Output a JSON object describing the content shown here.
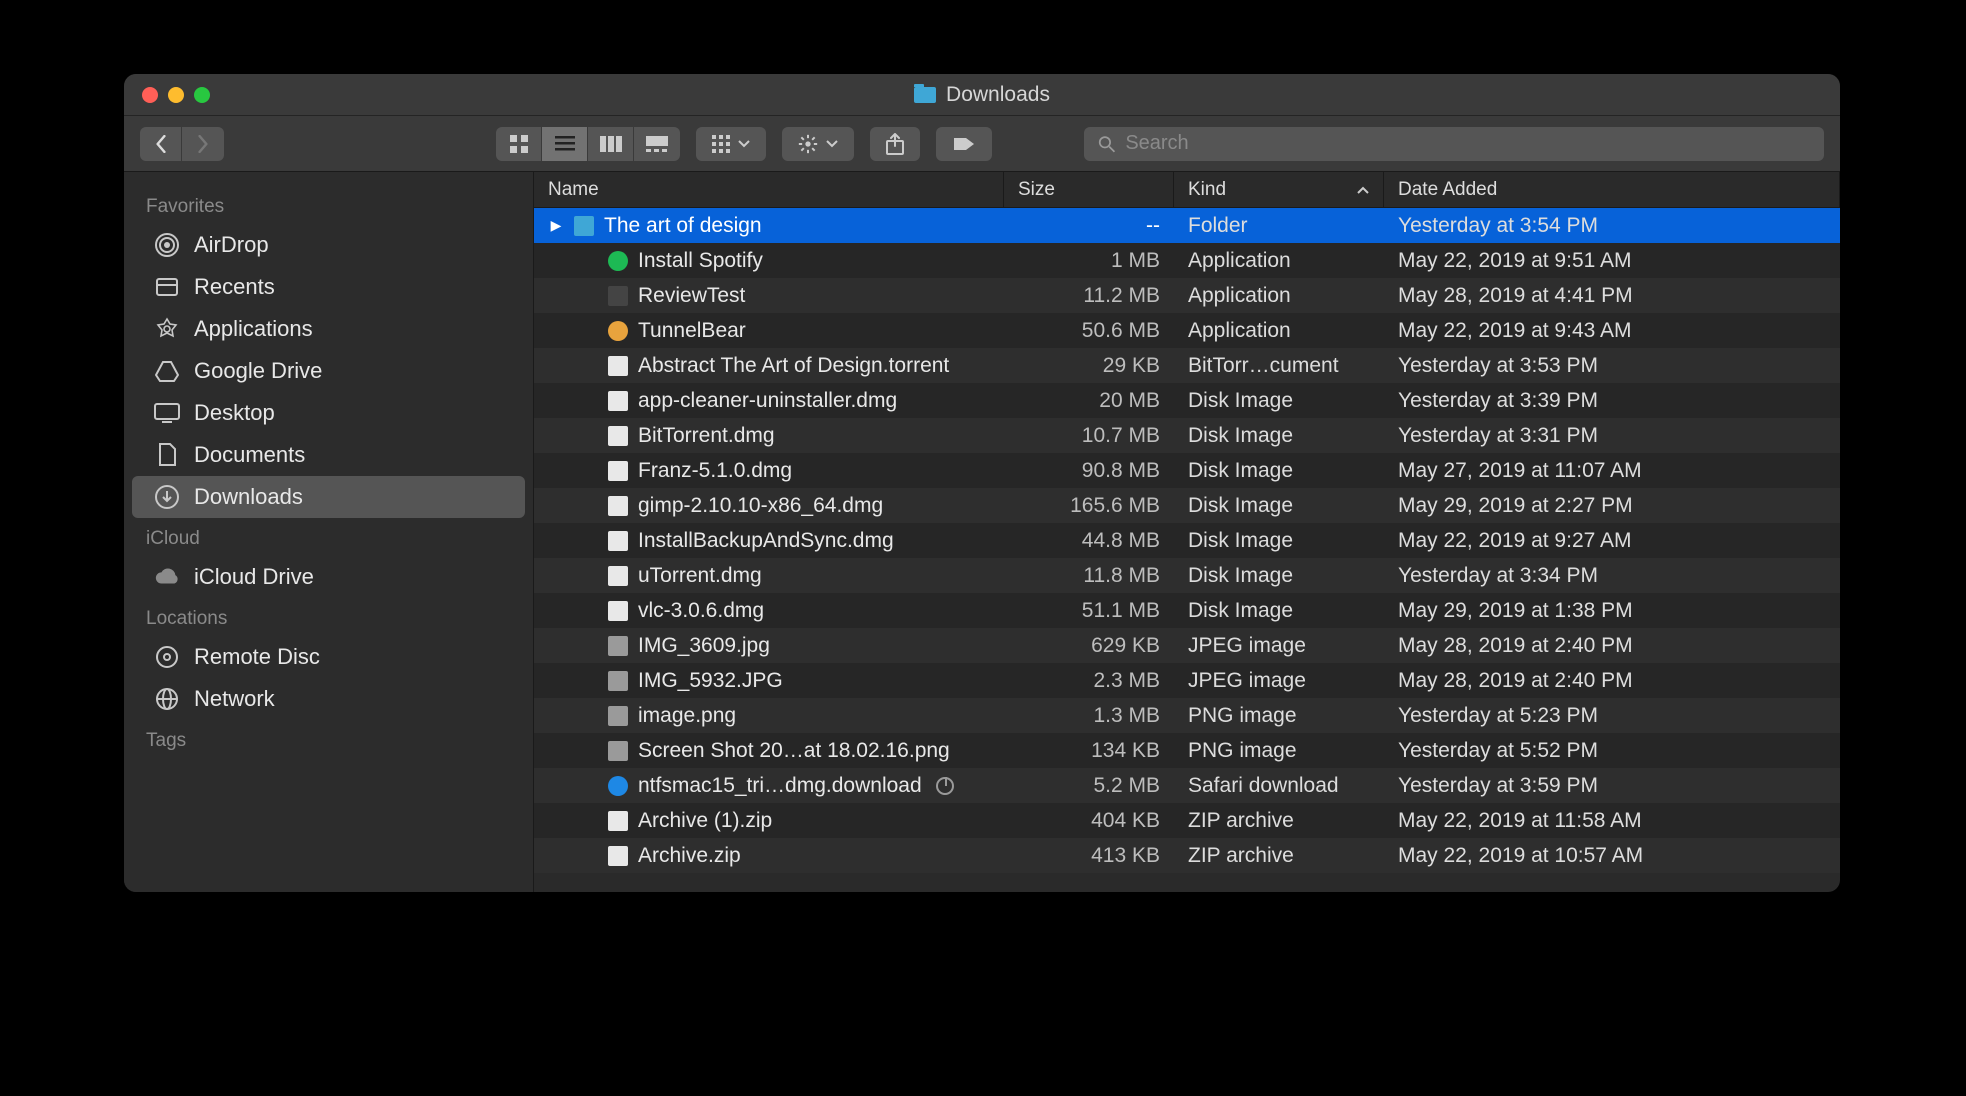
{
  "window": {
    "title": "Downloads"
  },
  "search": {
    "placeholder": "Search"
  },
  "sidebar": {
    "sections": [
      {
        "heading": "Favorites",
        "items": [
          {
            "icon": "airdrop",
            "label": "AirDrop"
          },
          {
            "icon": "recents",
            "label": "Recents"
          },
          {
            "icon": "apps",
            "label": "Applications"
          },
          {
            "icon": "gdrive",
            "label": "Google Drive"
          },
          {
            "icon": "desktop",
            "label": "Desktop"
          },
          {
            "icon": "documents",
            "label": "Documents"
          },
          {
            "icon": "downloads",
            "label": "Downloads",
            "active": true
          }
        ]
      },
      {
        "heading": "iCloud",
        "items": [
          {
            "icon": "icloud",
            "label": "iCloud Drive"
          }
        ]
      },
      {
        "heading": "Locations",
        "items": [
          {
            "icon": "disc",
            "label": "Remote Disc"
          },
          {
            "icon": "network",
            "label": "Network"
          }
        ]
      },
      {
        "heading": "Tags",
        "items": []
      }
    ]
  },
  "columns": {
    "name": "Name",
    "size": "Size",
    "kind": "Kind",
    "date": "Date Added",
    "sorted": "kind",
    "dir": "asc"
  },
  "rows": [
    {
      "selected": true,
      "folder": true,
      "icon": "folder",
      "name": "The art of design",
      "size": "--",
      "kind": "Folder",
      "date": "Yesterday at 3:54 PM"
    },
    {
      "icon": "spotify",
      "name": "Install Spotify",
      "size": "1 MB",
      "kind": "Application",
      "date": "May 22, 2019 at 9:51 AM"
    },
    {
      "icon": "app",
      "name": "ReviewTest",
      "size": "11.2 MB",
      "kind": "Application",
      "date": "May 28, 2019 at 4:41 PM"
    },
    {
      "icon": "tunnelbear",
      "name": "TunnelBear",
      "size": "50.6 MB",
      "kind": "Application",
      "date": "May 22, 2019 at 9:43 AM"
    },
    {
      "icon": "doc",
      "name": "Abstract The Art of Design.torrent",
      "size": "29 KB",
      "kind": "BitTorr…cument",
      "date": "Yesterday at 3:53 PM"
    },
    {
      "icon": "doc",
      "name": "app-cleaner-uninstaller.dmg",
      "size": "20 MB",
      "kind": "Disk Image",
      "date": "Yesterday at 3:39 PM"
    },
    {
      "icon": "doc",
      "name": "BitTorrent.dmg",
      "size": "10.7 MB",
      "kind": "Disk Image",
      "date": "Yesterday at 3:31 PM"
    },
    {
      "icon": "doc",
      "name": "Franz-5.1.0.dmg",
      "size": "90.8 MB",
      "kind": "Disk Image",
      "date": "May 27, 2019 at 11:07 AM"
    },
    {
      "icon": "doc",
      "name": "gimp-2.10.10-x86_64.dmg",
      "size": "165.6 MB",
      "kind": "Disk Image",
      "date": "May 29, 2019 at 2:27 PM"
    },
    {
      "icon": "doc",
      "name": "InstallBackupAndSync.dmg",
      "size": "44.8 MB",
      "kind": "Disk Image",
      "date": "May 22, 2019 at 9:27 AM"
    },
    {
      "icon": "doc",
      "name": "uTorrent.dmg",
      "size": "11.8 MB",
      "kind": "Disk Image",
      "date": "Yesterday at 3:34 PM"
    },
    {
      "icon": "doc",
      "name": "vlc-3.0.6.dmg",
      "size": "51.1 MB",
      "kind": "Disk Image",
      "date": "May 29, 2019 at 1:38 PM"
    },
    {
      "icon": "img",
      "name": "IMG_3609.jpg",
      "size": "629 KB",
      "kind": "JPEG image",
      "date": "May 28, 2019 at 2:40 PM"
    },
    {
      "icon": "img",
      "name": "IMG_5932.JPG",
      "size": "2.3 MB",
      "kind": "JPEG image",
      "date": "May 28, 2019 at 2:40 PM"
    },
    {
      "icon": "img",
      "name": "image.png",
      "size": "1.3 MB",
      "kind": "PNG image",
      "date": "Yesterday at 5:23 PM"
    },
    {
      "icon": "img",
      "name": "Screen Shot 20…at 18.02.16.png",
      "size": "134 KB",
      "kind": "PNG image",
      "date": "Yesterday at 5:52 PM"
    },
    {
      "icon": "download",
      "name": "ntfsmac15_tri…dmg.download",
      "size": "5.2 MB",
      "kind": "Safari download",
      "date": "Yesterday at 3:59 PM",
      "progress": true
    },
    {
      "icon": "doc",
      "name": "Archive (1).zip",
      "size": "404 KB",
      "kind": "ZIP archive",
      "date": "May 22, 2019 at 11:58 AM"
    },
    {
      "icon": "doc",
      "name": "Archive.zip",
      "size": "413 KB",
      "kind": "ZIP archive",
      "date": "May 22, 2019 at 10:57 AM"
    }
  ]
}
